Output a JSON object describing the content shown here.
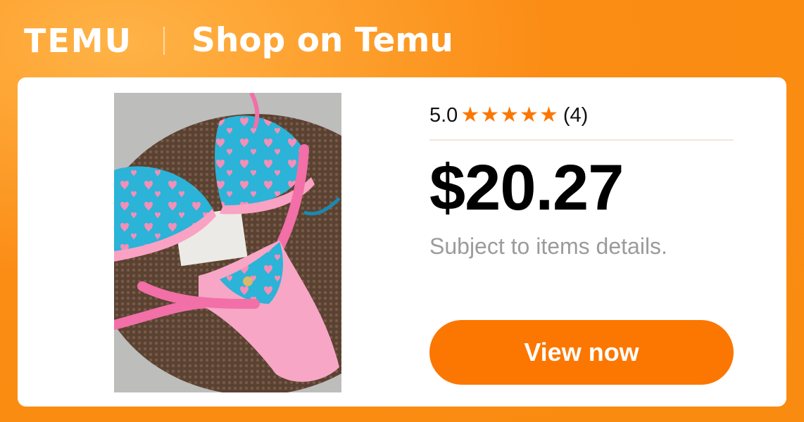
{
  "header": {
    "logo_text": "TEMU",
    "title": "Shop on Temu"
  },
  "product": {
    "rating_value": "5.0",
    "star_count": 5,
    "review_count": "(4)",
    "price": "$20.27",
    "note": "Subject to items details.",
    "cta_label": "View now",
    "image_icon": "product-photo"
  },
  "colors": {
    "brand_orange": "#fb7701",
    "background_orange": "#f98b10",
    "star": "#fb7701",
    "price_text": "#000000",
    "note_text": "#9b9b9b"
  }
}
